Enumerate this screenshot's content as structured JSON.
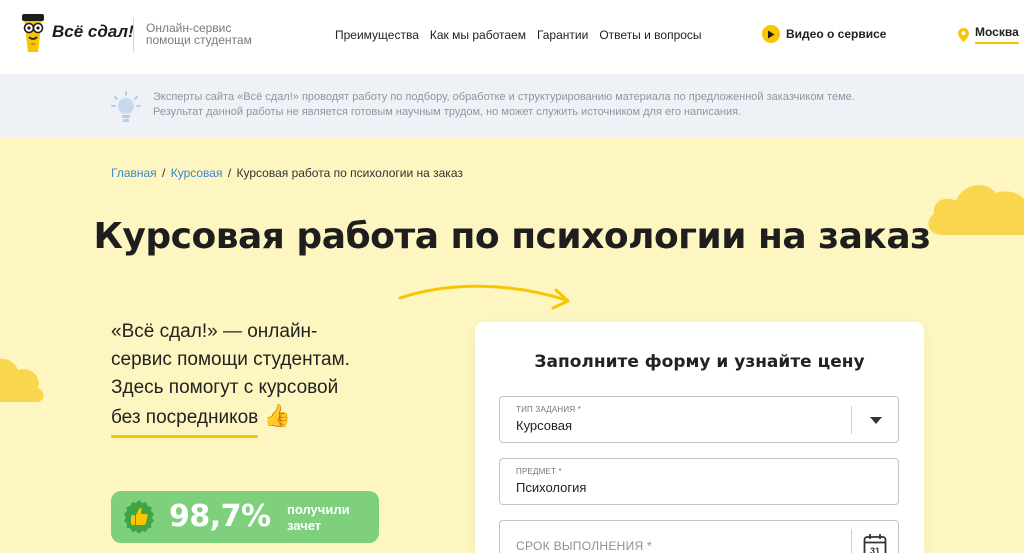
{
  "header": {
    "logo_text": "Всё сдал!",
    "tagline": "Онлайн-сервис помощи студентам",
    "nav": [
      "Преимущества",
      "Как мы работаем",
      "Гарантии",
      "Ответы и вопросы"
    ],
    "video_label": "Видео о сервисе",
    "city": "Москва"
  },
  "notice": {
    "line1": "Эксперты сайта «Всё сдал!» проводят работу по подбору, обработке и структурированию материала по предложенной заказчиком теме.",
    "line2": "Результат данной работы не является готовым научным трудом, но может служить источником для его написания."
  },
  "breadcrumb": {
    "home": "Главная",
    "section": "Курсовая",
    "current": "Курсовая работа по психологии на заказ",
    "separator": "/"
  },
  "page_title": "Курсовая работа по психологии на заказ",
  "lead": {
    "line1": "«Всё сдал!» — онлайн-",
    "line2": "сервис помощи студентам.",
    "line3": "Здесь помогут с курсовой",
    "line4": "без посредников",
    "emoji": "👍"
  },
  "stat": {
    "value": "98,7%",
    "label": "получили зачет"
  },
  "form": {
    "title": "Заполните форму и узнайте цену",
    "work_type": {
      "label": "Тип задания *",
      "value": "Курсовая"
    },
    "subject": {
      "label": "Предмет *",
      "value": "Психология"
    },
    "deadline": {
      "placeholder": "Срок выполнения *",
      "calendar_day": "31"
    }
  },
  "colors": {
    "accent_yellow": "#f7c600",
    "hero_bg": "#fdf6c0",
    "notice_bg": "#eef1f6",
    "link_blue": "#3b87d1",
    "badge_green": "#7ed07d"
  },
  "icons": [
    "mascot-icon",
    "play-icon",
    "location-pin-icon",
    "lightbulb-icon",
    "arrow-icon",
    "thumbs-up-icon",
    "chevron-down-icon",
    "calendar-icon"
  ]
}
